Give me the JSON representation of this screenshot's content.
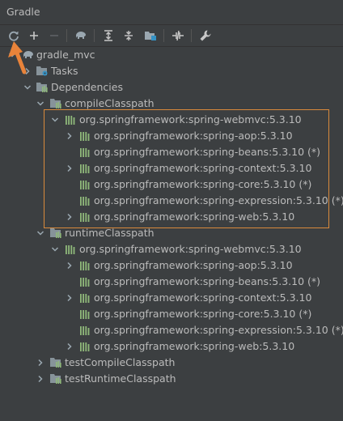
{
  "window": {
    "title": "Gradle"
  },
  "toolbar": {
    "buttons": [
      {
        "icon": "refresh-icon"
      },
      {
        "icon": "plus-icon"
      },
      {
        "icon": "minus-icon"
      },
      {
        "icon": "elephant-icon"
      },
      {
        "icon": "expand-all-icon"
      },
      {
        "icon": "collapse-all-icon"
      },
      {
        "icon": "analyze-deps-icon"
      },
      {
        "icon": "toggle-offline-icon"
      },
      {
        "icon": "wrench-icon"
      }
    ]
  },
  "tree": {
    "root": "gradle_mvc",
    "tasks": "Tasks",
    "dependencies": "Dependencies",
    "compile": {
      "label": "compileClasspath",
      "webmvc": "org.springframework:spring-webmvc:5.3.10",
      "children": [
        "org.springframework:spring-aop:5.3.10",
        "org.springframework:spring-beans:5.3.10 (*)",
        "org.springframework:spring-context:5.3.10",
        "org.springframework:spring-core:5.3.10 (*)",
        "org.springframework:spring-expression:5.3.10 (*)",
        "org.springframework:spring-web:5.3.10"
      ]
    },
    "runtime": {
      "label": "runtimeClasspath",
      "webmvc": "org.springframework:spring-webmvc:5.3.10",
      "children": [
        "org.springframework:spring-aop:5.3.10",
        "org.springframework:spring-beans:5.3.10 (*)",
        "org.springframework:spring-context:5.3.10",
        "org.springframework:spring-core:5.3.10 (*)",
        "org.springframework:spring-expression:5.3.10 (*)",
        "org.springframework:spring-web:5.3.10"
      ]
    },
    "test_compile": "testCompileClasspath",
    "test_runtime": "testRuntimeClasspath"
  },
  "colors": {
    "highlight": "#d98a3c",
    "arrow_annotation": "#e8833a",
    "lib_icon": "#8fb87a"
  }
}
